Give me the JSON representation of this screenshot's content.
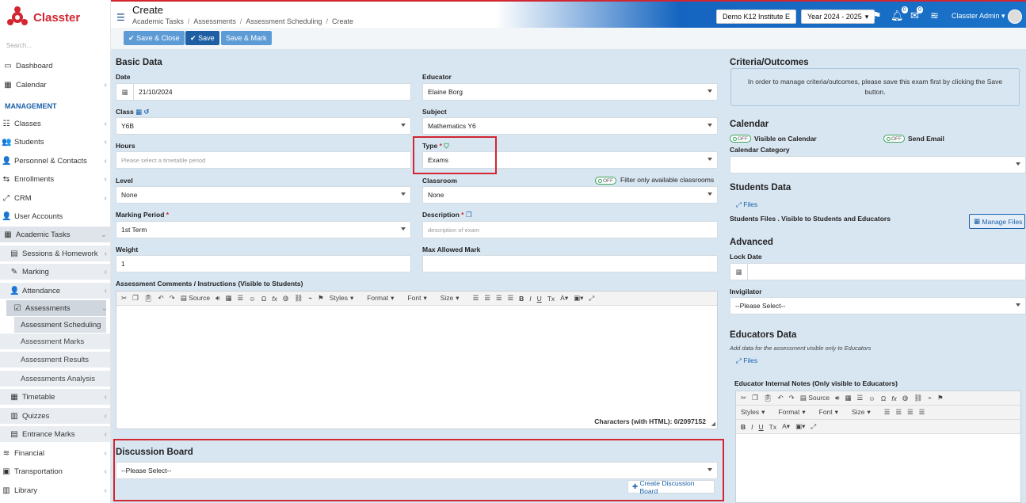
{
  "app": {
    "name": "Classter",
    "brand_color": "#d22630",
    "accent_color": "#1565c0"
  },
  "sidebar": {
    "search_placeholder": "Search...",
    "section_label": "MANAGEMENT",
    "items": [
      {
        "label": "Dashboard",
        "icon": "monitor-icon"
      },
      {
        "label": "Calendar",
        "icon": "calendar-icon"
      },
      {
        "label": "Classes",
        "icon": "classes-icon"
      },
      {
        "label": "Students",
        "icon": "students-icon"
      },
      {
        "label": "Personnel & Contacts",
        "icon": "personnel-icon"
      },
      {
        "label": "Enrollments",
        "icon": "enrollments-icon"
      },
      {
        "label": "CRM",
        "icon": "crm-icon"
      },
      {
        "label": "User Accounts",
        "icon": "user-key-icon"
      },
      {
        "label": "Academic Tasks",
        "icon": "grid-icon"
      },
      {
        "label": "Sessions & Homework",
        "icon": "sessions-icon"
      },
      {
        "label": "Marking",
        "icon": "marking-icon"
      },
      {
        "label": "Attendance",
        "icon": "attendance-icon"
      },
      {
        "label": "Assessments",
        "icon": "assessment-icon"
      },
      {
        "label": "Assessment Scheduling"
      },
      {
        "label": "Assessment Marks"
      },
      {
        "label": "Assessment Results"
      },
      {
        "label": "Assessments Analysis"
      },
      {
        "label": "Timetable",
        "icon": "timetable-icon"
      },
      {
        "label": "Quizzes",
        "icon": "quiz-icon"
      },
      {
        "label": "Entrance Marks",
        "icon": "entrance-icon"
      },
      {
        "label": "Financial",
        "icon": "financial-icon"
      },
      {
        "label": "Transportation",
        "icon": "bus-icon"
      },
      {
        "label": "Library",
        "icon": "library-icon"
      }
    ]
  },
  "header": {
    "title": "Create",
    "breadcrumbs": [
      "Academic Tasks",
      "Assessments",
      "Assessment Scheduling",
      "Create"
    ],
    "institute": "Demo K12 Institute E",
    "year": "Year 2024 - 2025",
    "notifications_count": "0",
    "messages_count": "0",
    "user": "Classter Admin"
  },
  "actions": {
    "save_close": "Save & Close",
    "save": "Save",
    "save_mark": "Save & Mark"
  },
  "basic": {
    "title": "Basic Data",
    "date_label": "Date",
    "date_value": "21/10/2024",
    "educator_label": "Educator",
    "educator_value": "Elaine Borg",
    "class_label": "Class",
    "class_value": "Y6B",
    "subject_label": "Subject",
    "subject_value": "Mathematics Y6",
    "hours_label": "Hours",
    "hours_placeholder": "Please select a timetable period",
    "type_label": "Type",
    "type_value": "Exams",
    "level_label": "Level",
    "level_value": "None",
    "classroom_label": "Classroom",
    "classroom_value": "None",
    "filter_toggle": "OFF",
    "filter_label": "Filter only available classrooms",
    "period_label": "Marking Period",
    "period_value": "1st Term",
    "description_label": "Description",
    "description_placeholder": "description of exam",
    "weight_label": "Weight",
    "weight_value": "1",
    "max_mark_label": "Max Allowed Mark",
    "comments_label": "Assessment Comments / Instructions (Visible to Students)",
    "chars_label": "Characters (with HTML): 0/2097152",
    "required_mark": "*"
  },
  "editor": {
    "source": "Source",
    "styles": "Styles",
    "format": "Format",
    "font": "Font",
    "size": "Size",
    "bold": "B",
    "italic": "I",
    "underline": "U",
    "clear": "Tx"
  },
  "discussion": {
    "title": "Discussion Board",
    "select": "--Please Select--",
    "create": "Create Discussion Board"
  },
  "criteria": {
    "title": "Criteria/Outcomes",
    "message": "In order to manage criteria/outcomes, please save this exam first by clicking the Save button."
  },
  "calendar": {
    "title": "Calendar",
    "toggle": "OFF",
    "visible_label": "Visible on Calendar",
    "email_label": "Send Email",
    "category_label": "Calendar Category"
  },
  "students_data": {
    "title": "Students Data",
    "files_link": "Files",
    "files_desc": "Students Files . Visible to Students and Educators",
    "manage": "Manage Files"
  },
  "advanced": {
    "title": "Advanced",
    "lock_label": "Lock Date",
    "invigilator_label": "Invigilator",
    "invigilator_value": "--Please Select--"
  },
  "educators_data": {
    "title": "Educators Data",
    "subtitle": "Add data for the assessment visible only to Educators",
    "files_link": "Files",
    "notes_label": "Educator Internal Notes (Only visible to Educators)"
  }
}
